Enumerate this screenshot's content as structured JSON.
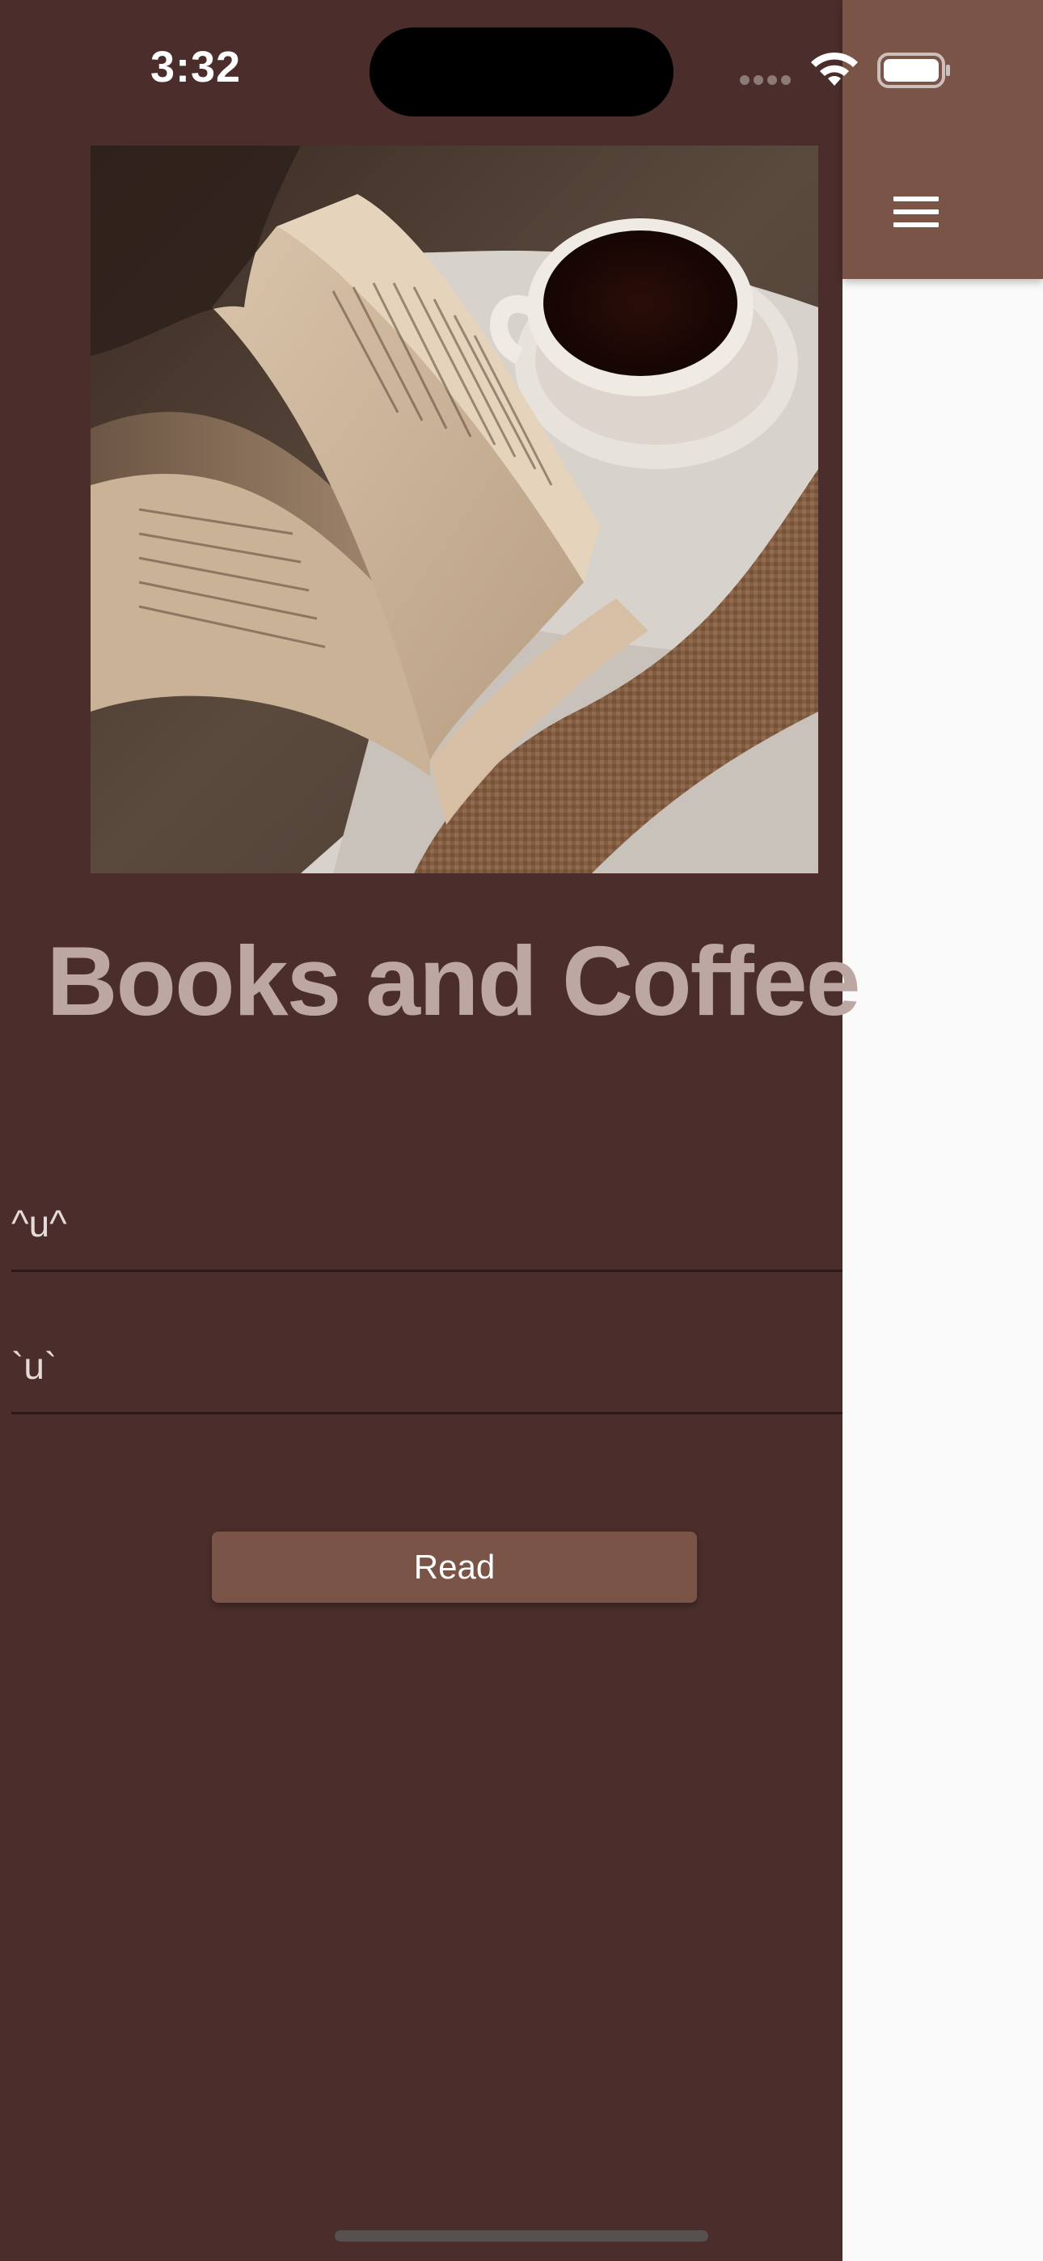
{
  "status_bar": {
    "time": "3:32"
  },
  "app_bar": {
    "menu_icon": "hamburger-menu-icon"
  },
  "hero": {
    "image": "open book with cup of coffee on white fabric"
  },
  "title": "Books and Coffee",
  "fields": [
    {
      "value": "^u^"
    },
    {
      "value": "`u`"
    }
  ],
  "read_button": {
    "label": "Read"
  },
  "colors": {
    "drawer_background": "#4B2E2B",
    "app_bar": "#7A5547",
    "button": "#7A5547",
    "title": "#BCA7A2",
    "main_background": "#FAFAFA"
  }
}
